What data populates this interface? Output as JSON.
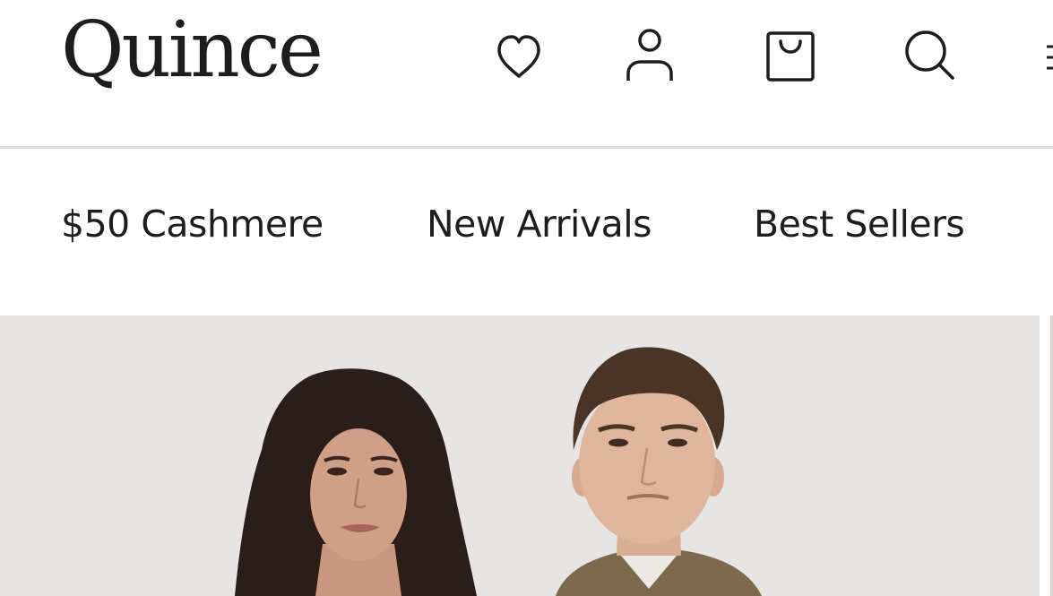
{
  "header": {
    "logo_text": "Quince",
    "icons": {
      "wishlist": "heart-icon",
      "account": "user-icon",
      "cart": "shopping-bag-icon",
      "search": "search-icon",
      "menu": "menu-icon"
    }
  },
  "category_nav": {
    "items": [
      {
        "label": "$50 Cashmere"
      },
      {
        "label": "New Arrivals"
      },
      {
        "label": "Best Sellers"
      }
    ]
  },
  "hero": {
    "image": "hero-photo-woman-and-man-on-light-grey-background"
  },
  "colors": {
    "text": "#1d1d1d",
    "divider": "#dcdcdc",
    "hero_background": "#e6e5e4"
  }
}
